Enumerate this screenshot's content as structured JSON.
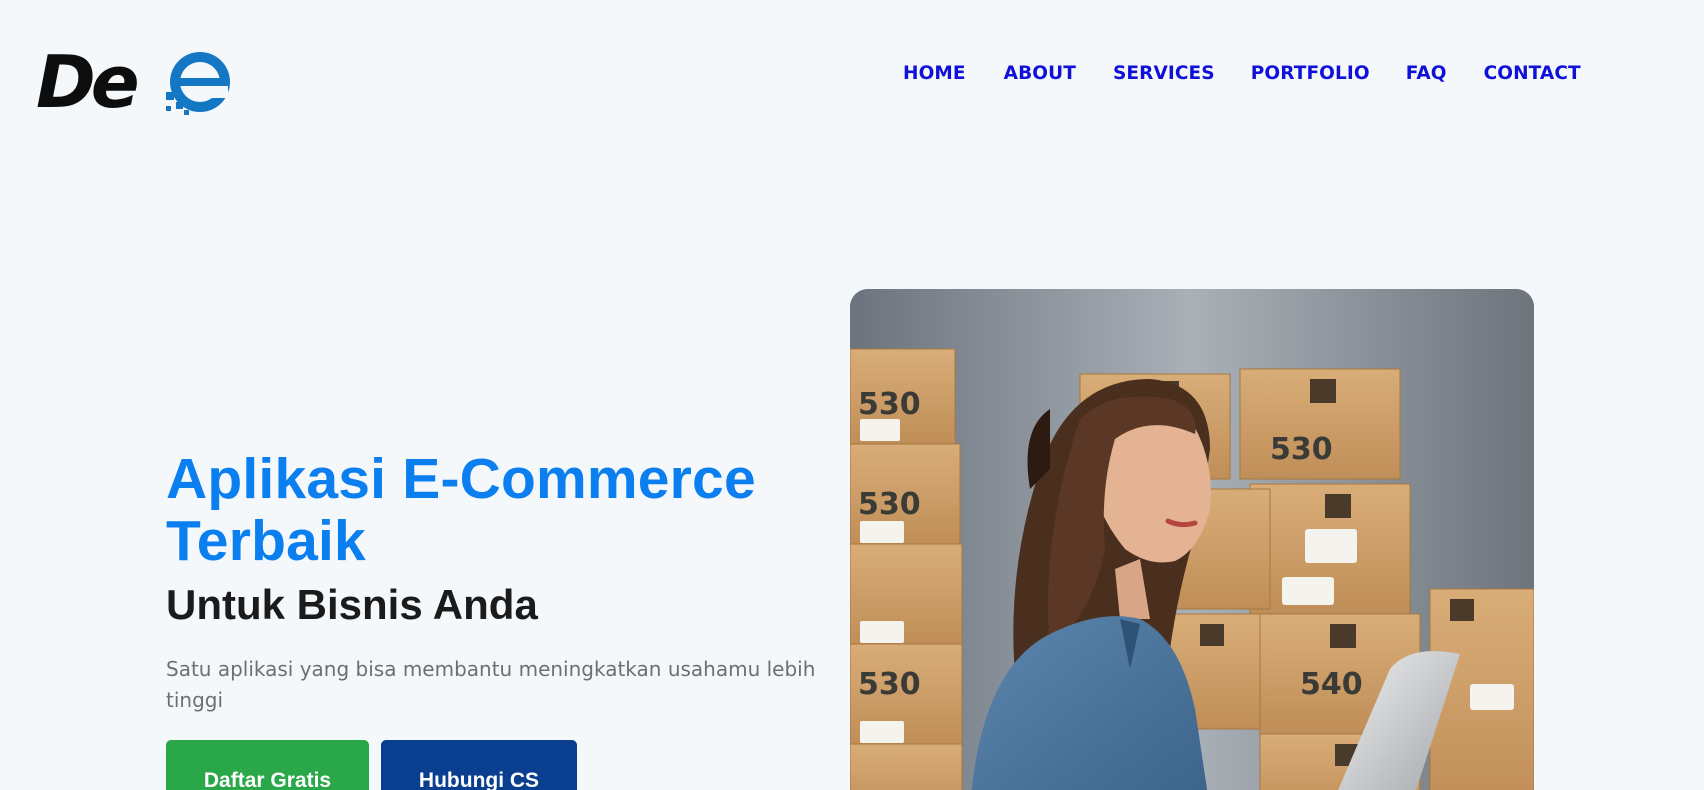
{
  "logo": {
    "text": "De",
    "alt": "De-e logo"
  },
  "nav": {
    "home": "HOME",
    "about": "ABOUT",
    "services": "SERVICES",
    "portfolio": "PORTFOLIO",
    "faq": "FAQ",
    "contact": "CONTACT"
  },
  "hero": {
    "title_line1": "Aplikasi E-Commerce",
    "title_line2": "Terbaik",
    "subtitle": "Untuk Bisnis Anda",
    "description": "Satu aplikasi yang bisa membantu meningkatkan usahamu lebih tinggi",
    "primary_button": "Daftar Gratis",
    "secondary_button": "Hubungi CS",
    "image_alt": "Woman with laptop in front of stacked cardboard boxes",
    "box_labels": [
      "530",
      "530",
      "530",
      "530",
      "540"
    ]
  },
  "colors": {
    "background": "#f4f8fb",
    "nav_link": "#1010d8",
    "title_blue": "#0b7ff0",
    "primary_button": "#2aa748",
    "secondary_button": "#0a3e8e"
  },
  "icons": {
    "logo_mark": "e-circle-logo-icon"
  }
}
